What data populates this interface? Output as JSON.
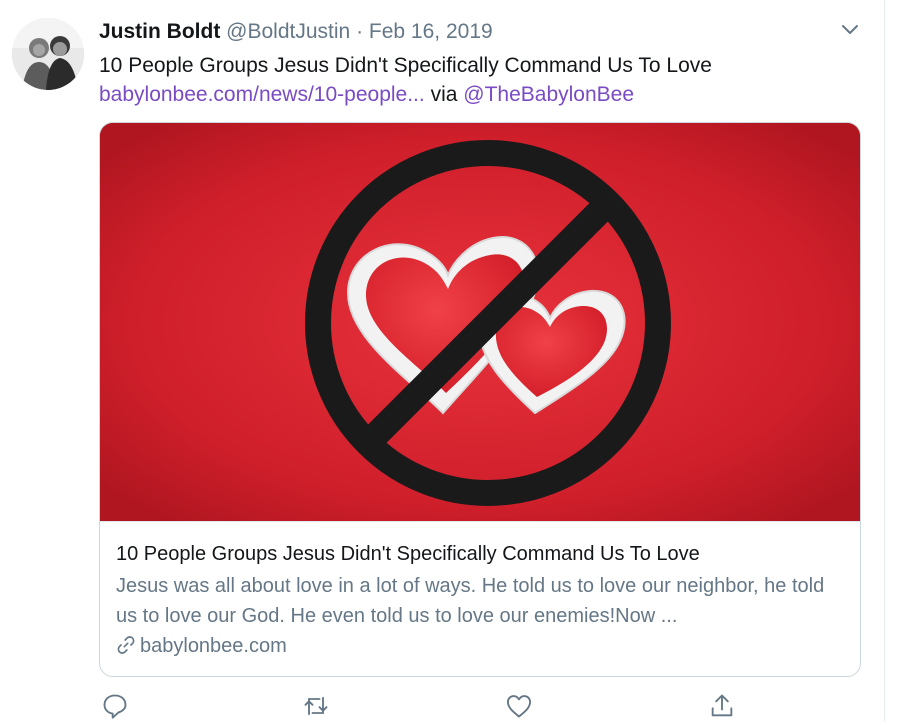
{
  "tweet": {
    "author_name": "Justin Boldt",
    "author_handle": "@BoldtJustin",
    "separator": "·",
    "date": "Feb 16, 2019",
    "text": "10 People Groups Jesus Didn't Specifically Command Us To Love",
    "link_text": "babylonbee.com/news/10-people...",
    "via_text": "via",
    "via_handle": "@TheBabylonBee"
  },
  "card": {
    "title": "10 People Groups Jesus Didn't Specifically Command Us To Love",
    "description": "Jesus was all about love in a lot of ways. He told us to love our neighbor, he told us to love our God. He even told us to love our enemies!Now ...",
    "domain": "babylonbee.com"
  },
  "icons": {
    "menu": "chevron-down-icon",
    "reply": "reply-icon",
    "retweet": "retweet-icon",
    "like": "heart-icon",
    "share": "share-icon",
    "link": "link-icon"
  },
  "colors": {
    "link": "#794bc4",
    "muted": "#657786",
    "text": "#14171a",
    "card_image_red": "#d0202c"
  }
}
